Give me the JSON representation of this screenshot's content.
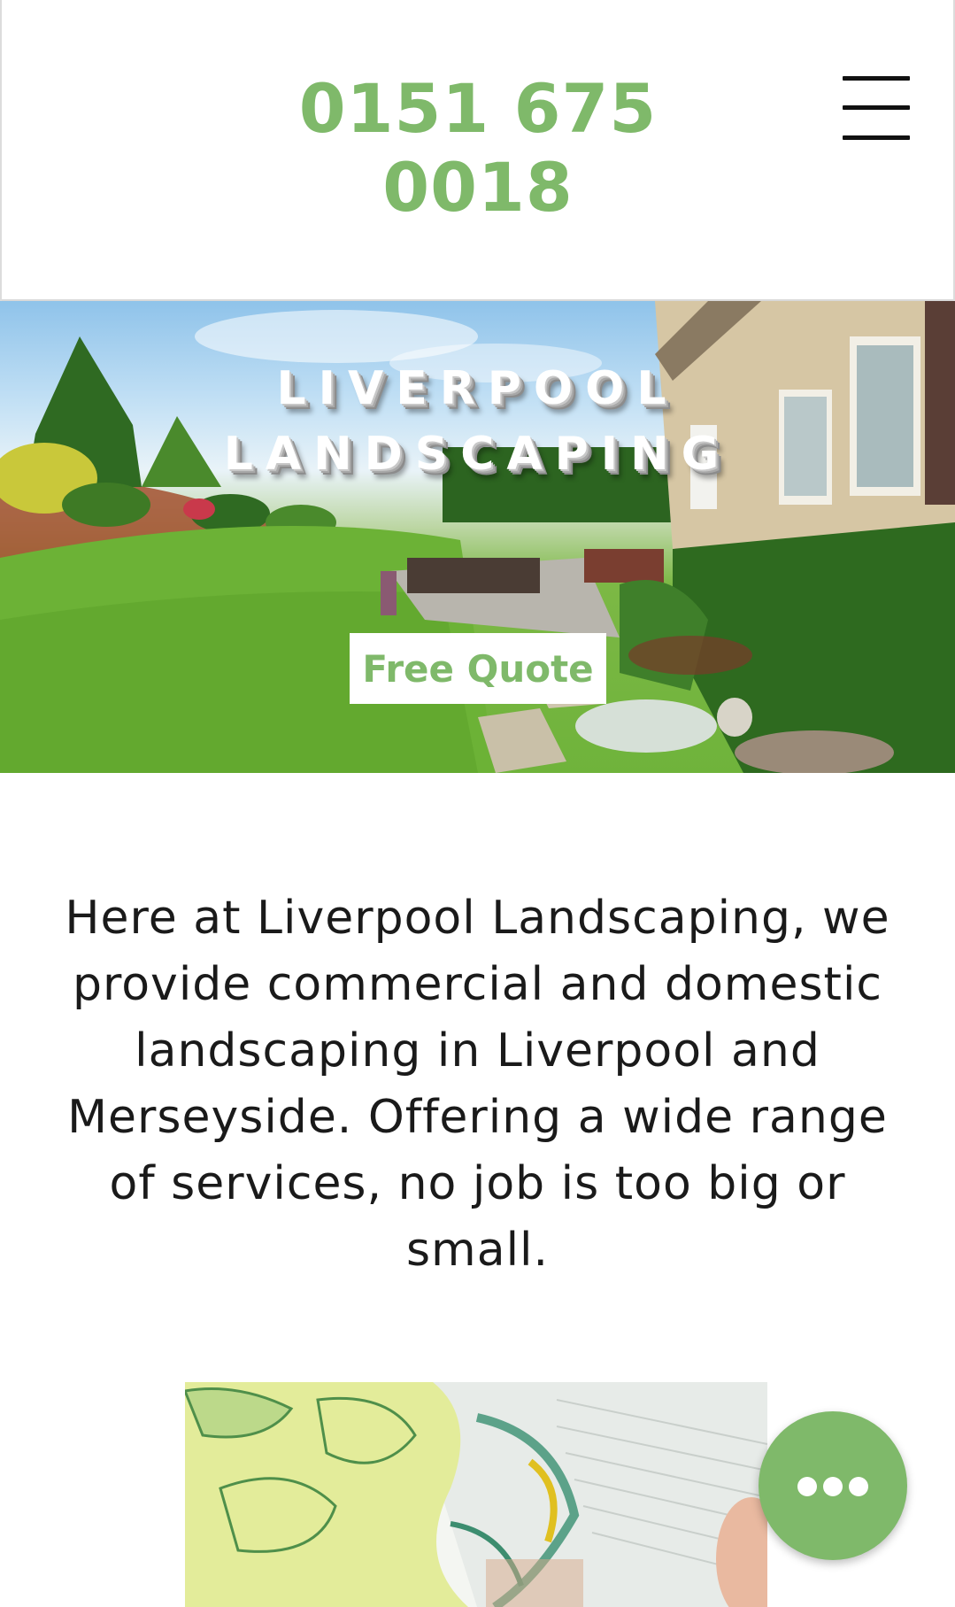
{
  "header": {
    "phone": "0151 675 0018",
    "menu_icon": "hamburger-menu-icon"
  },
  "hero": {
    "title_line1": "LIVERPOOL",
    "title_line2": "LANDSCAPING",
    "cta_label": "Free Quote"
  },
  "intro": {
    "text": "Here at Liverpool Landscaping, we provide commercial and domestic landscaping in Liverpool and Merseyside. Offering a wide range of services, no job is too big or small."
  },
  "chat": {
    "icon": "more-dots-icon"
  },
  "colors": {
    "accent": "#7fb96a",
    "text": "#1a1a1a",
    "background": "#ffffff"
  }
}
